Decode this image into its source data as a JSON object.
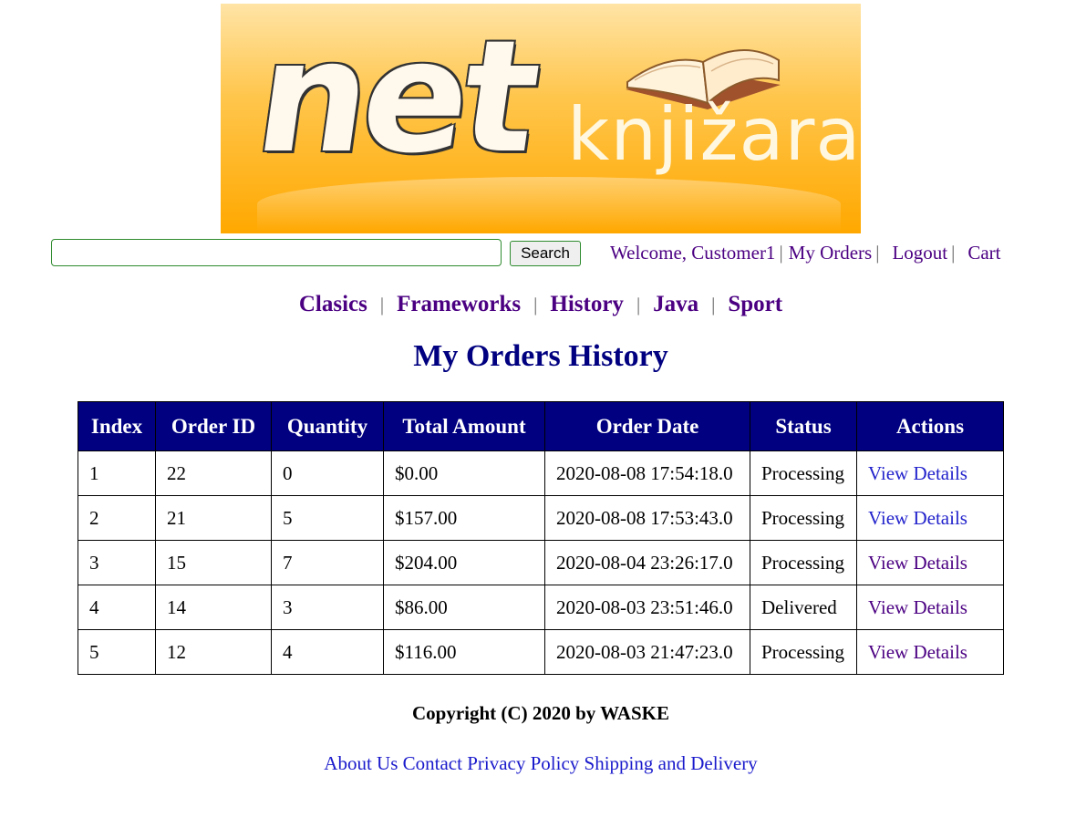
{
  "banner": {
    "logo_main": "net",
    "logo_word": "knjižara",
    "colors": {
      "top": "#ffe4a6",
      "bottom": "#ffa800"
    }
  },
  "search": {
    "value": "",
    "placeholder": "",
    "button_label": "Search"
  },
  "user_nav": {
    "welcome": "Welcome, Customer1",
    "my_orders": "My Orders",
    "logout": "Logout",
    "cart": "Cart",
    "separator": "|"
  },
  "categories": {
    "items": [
      "Clasics",
      "Frameworks",
      "History",
      "Java",
      "Sport"
    ],
    "separator": "|"
  },
  "page_title": "My Orders History",
  "orders_table": {
    "headers": [
      "Index",
      "Order ID",
      "Quantity",
      "Total Amount",
      "Order Date",
      "Status",
      "Actions"
    ],
    "rows": [
      {
        "index": "1",
        "order_id": "22",
        "quantity": "0",
        "total": "$0.00",
        "date": "2020-08-08 17:54:18.0",
        "status": "Processing",
        "action": "View Details"
      },
      {
        "index": "2",
        "order_id": "21",
        "quantity": "5",
        "total": "$157.00",
        "date": "2020-08-08 17:53:43.0",
        "status": "Processing",
        "action": "View Details"
      },
      {
        "index": "3",
        "order_id": "15",
        "quantity": "7",
        "total": "$204.00",
        "date": "2020-08-04 23:26:17.0",
        "status": "Processing",
        "action": "View Details"
      },
      {
        "index": "4",
        "order_id": "14",
        "quantity": "3",
        "total": "$86.00",
        "date": "2020-08-03 23:51:46.0",
        "status": "Delivered",
        "action": "View Details"
      },
      {
        "index": "5",
        "order_id": "12",
        "quantity": "4",
        "total": "$116.00",
        "date": "2020-08-03 21:47:23.0",
        "status": "Processing",
        "action": "View Details"
      }
    ],
    "header_bg": "#000080"
  },
  "footer": {
    "copyright": "Copyright (C) 2020 by WASKE",
    "links": [
      "About Us",
      "Contact",
      "Privacy Policy",
      "Shipping and Delivery"
    ]
  },
  "colors": {
    "link_visited": "#4b0082",
    "link": "#1a1acc",
    "title": "#000080"
  }
}
